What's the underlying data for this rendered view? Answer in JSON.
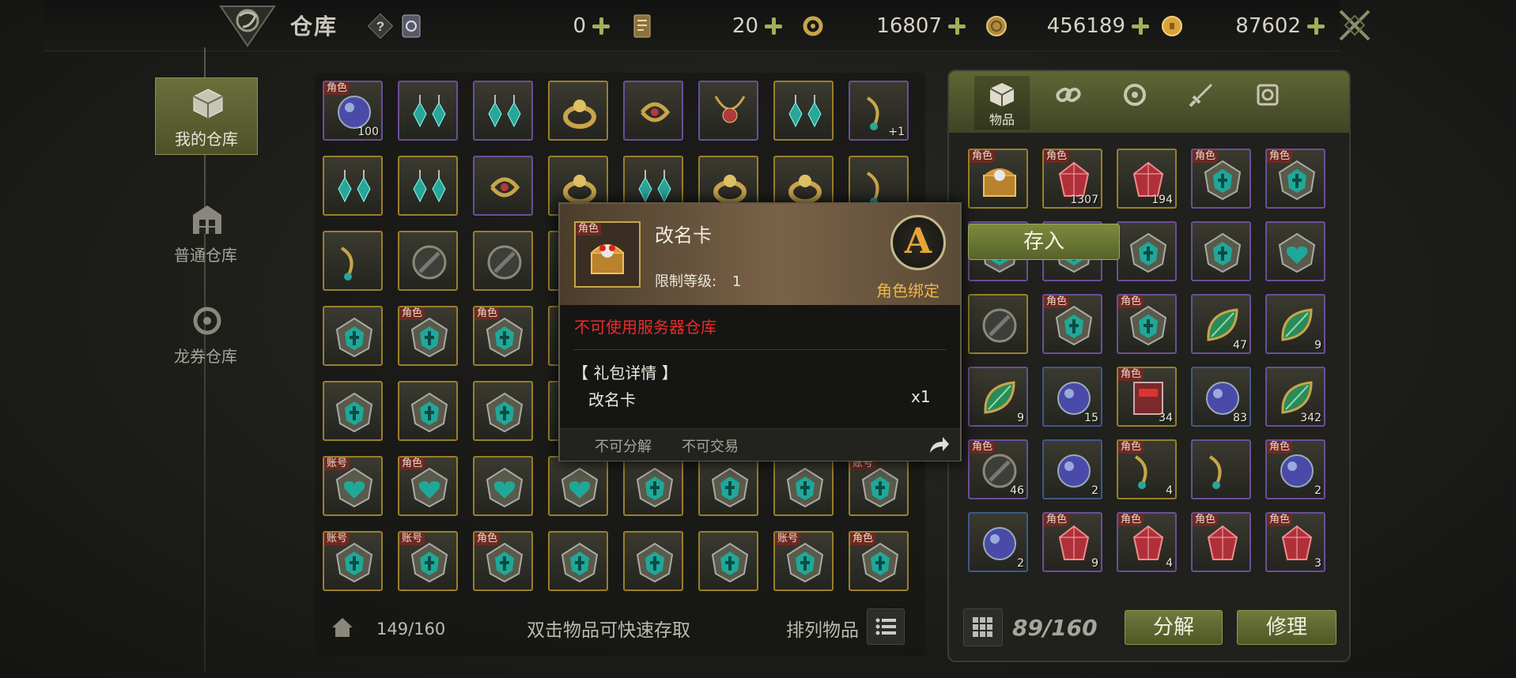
{
  "topbar": {
    "title": "仓库",
    "currencies": [
      {
        "name": "ticket",
        "value": "0"
      },
      {
        "name": "card",
        "value": "20"
      },
      {
        "name": "dragon-coupon",
        "value": "16807"
      },
      {
        "name": "silver",
        "value": "456189"
      },
      {
        "name": "gold",
        "value": "87602"
      }
    ]
  },
  "sidebar": {
    "items": [
      {
        "label": "我的仓库",
        "active": true
      },
      {
        "label": "普通仓库",
        "active": false
      },
      {
        "label": "龙券仓库",
        "active": false
      }
    ]
  },
  "warehouse": {
    "rows": [
      [
        {
          "b": "purple",
          "tag": "角色",
          "cnt": "100",
          "i": "orb"
        },
        {
          "b": "purple",
          "i": "earring"
        },
        {
          "b": "purple",
          "i": "earring"
        },
        {
          "b": "gold",
          "i": "ring"
        },
        {
          "b": "purple",
          "i": "swirl"
        },
        {
          "b": "purple",
          "i": "necklace"
        },
        {
          "b": "gold",
          "i": "earring"
        },
        {
          "b": "purple",
          "cnt": "+1",
          "i": "chain"
        }
      ],
      [
        {
          "b": "gold",
          "i": "earring"
        },
        {
          "b": "gold",
          "i": "earring"
        },
        {
          "b": "purple",
          "i": "swirl"
        },
        {
          "b": "gold",
          "i": "ring"
        },
        {
          "b": "gold",
          "i": "earring"
        },
        {
          "b": "gold",
          "i": "ring"
        },
        {
          "b": "gold",
          "i": "ring"
        },
        {
          "b": "gold",
          "i": "chain"
        }
      ],
      [
        {
          "b": "gold",
          "i": "chain"
        },
        {
          "b": "gold",
          "i": "disc"
        },
        {
          "b": "gold",
          "i": "disc"
        },
        {
          "b": "gold",
          "i": "disc"
        },
        {
          "b": "gold",
          "i": "disc"
        },
        {
          "b": "gold",
          "i": "disc"
        },
        {
          "b": "gold",
          "i": "disc"
        },
        {
          "b": "gold",
          "i": "disc"
        }
      ],
      [
        {
          "b": "gold",
          "i": "shield"
        },
        {
          "b": "gold",
          "tag": "角色",
          "i": "shield"
        },
        {
          "b": "gold",
          "tag": "角色",
          "i": "shield"
        },
        {
          "b": "gold",
          "i": "shield"
        },
        {
          "b": "gold",
          "i": "shield"
        },
        {
          "b": "gold",
          "i": "shield"
        },
        {
          "b": "gold",
          "i": "shield"
        },
        {
          "b": "gold",
          "i": "shield"
        }
      ],
      [
        {
          "b": "gold",
          "i": "shield"
        },
        {
          "b": "gold",
          "i": "shield"
        },
        {
          "b": "gold",
          "i": "shield"
        },
        {
          "b": "gold",
          "i": "shield"
        },
        {
          "b": "gold",
          "i": "shield"
        },
        {
          "b": "gold",
          "i": "shield"
        },
        {
          "b": "gold",
          "i": "shield"
        },
        {
          "b": "gold",
          "i": "shield"
        }
      ],
      [
        {
          "b": "gold",
          "tag": "账号",
          "i": "heart"
        },
        {
          "b": "gold",
          "tag": "角色",
          "i": "heart"
        },
        {
          "b": "gold",
          "i": "heart"
        },
        {
          "b": "gold",
          "i": "heart"
        },
        {
          "b": "gold",
          "i": "shield"
        },
        {
          "b": "gold",
          "i": "shield"
        },
        {
          "b": "gold",
          "i": "shield"
        },
        {
          "b": "gold",
          "tag": "账号",
          "i": "shield"
        }
      ],
      [
        {
          "b": "gold",
          "tag": "账号",
          "i": "shield"
        },
        {
          "b": "gold",
          "tag": "账号",
          "i": "shield"
        },
        {
          "b": "gold",
          "tag": "角色",
          "i": "shield"
        },
        {
          "b": "gold",
          "i": "shield"
        },
        {
          "b": "gold",
          "i": "shield"
        },
        {
          "b": "gold",
          "i": "shield"
        },
        {
          "b": "gold",
          "tag": "账号",
          "i": "shield"
        },
        {
          "b": "gold",
          "tag": "角色",
          "i": "shield"
        }
      ]
    ],
    "capacity": "149/160",
    "hint": "双击物品可快速存取",
    "sort_label": "排列物品"
  },
  "inventory": {
    "tabs": [
      {
        "label": "物品",
        "icon": "box-icon"
      },
      {
        "label": "",
        "icon": "link-icon"
      },
      {
        "label": "",
        "icon": "compass-icon"
      },
      {
        "label": "",
        "icon": "sword-icon"
      },
      {
        "label": "",
        "icon": "scroll-icon"
      }
    ],
    "rows": [
      [
        {
          "b": "gold",
          "tag": "角色",
          "i": "chest"
        },
        {
          "b": "gold",
          "tag": "角色",
          "cnt": "1307",
          "i": "gem"
        },
        {
          "b": "gold",
          "cnt": "194",
          "i": "gem"
        },
        {
          "b": "purple",
          "tag": "角色",
          "i": "shield"
        },
        {
          "b": "purple",
          "tag": "角色",
          "i": "shield"
        }
      ],
      [
        {
          "b": "purple",
          "i": "shield"
        },
        {
          "b": "purple",
          "i": "shield"
        },
        {
          "b": "purple",
          "i": "shield"
        },
        {
          "b": "purple",
          "i": "shield"
        },
        {
          "b": "purple",
          "i": "heart"
        }
      ],
      [
        {
          "b": "gold",
          "i": "disc"
        },
        {
          "b": "purple",
          "tag": "角色",
          "i": "shield"
        },
        {
          "b": "purple",
          "tag": "角色",
          "i": "shield"
        },
        {
          "b": "purple",
          "cnt": "47",
          "i": "leaf"
        },
        {
          "b": "purple",
          "cnt": "9",
          "i": "leaf"
        }
      ],
      [
        {
          "b": "purple",
          "cnt": "9",
          "i": "leaf"
        },
        {
          "b": "blue",
          "cnt": "15",
          "i": "orb"
        },
        {
          "b": "gold",
          "tag": "角色",
          "cnt": "34",
          "i": "book"
        },
        {
          "b": "blue",
          "cnt": "83",
          "i": "orb"
        },
        {
          "b": "purple",
          "cnt": "342",
          "i": "leaf"
        }
      ],
      [
        {
          "b": "purple",
          "tag": "角色",
          "cnt": "46",
          "i": "disc"
        },
        {
          "b": "blue",
          "cnt": "2",
          "i": "orb"
        },
        {
          "b": "gold",
          "tag": "角色",
          "cnt": "4",
          "i": "chain"
        },
        {
          "b": "purple",
          "i": "chain"
        },
        {
          "b": "purple",
          "tag": "角色",
          "cnt": "2",
          "i": "orb"
        }
      ],
      [
        {
          "b": "blue",
          "cnt": "2",
          "i": "orb"
        },
        {
          "b": "purple",
          "tag": "角色",
          "cnt": "9",
          "i": "gem"
        },
        {
          "b": "purple",
          "tag": "角色",
          "cnt": "4",
          "i": "gem"
        },
        {
          "b": "purple",
          "tag": "角色",
          "i": "gem"
        },
        {
          "b": "purple",
          "tag": "角色",
          "cnt": "3",
          "i": "gem"
        }
      ]
    ],
    "capacity": "89/160",
    "decompose_label": "分解",
    "repair_label": "修理"
  },
  "tooltip": {
    "tag": "角色",
    "name": "改名卡",
    "level_label": "限制等级:",
    "level_value": "1",
    "grade": "A",
    "bind": "角色绑定",
    "warning": "不可使用服务器仓库",
    "detail_header": "【 礼包详情 】",
    "detail_item": "改名卡",
    "detail_qty": "x1",
    "flag1": "不可分解",
    "flag2": "不可交易",
    "deposit_label": "存入"
  },
  "colors": {
    "gold": "#9a7f2a",
    "purple": "#6a4f9a",
    "accent_green": "#7c8a3e",
    "warning_red": "#ea2b2b",
    "bind_orange": "#f0b746"
  }
}
